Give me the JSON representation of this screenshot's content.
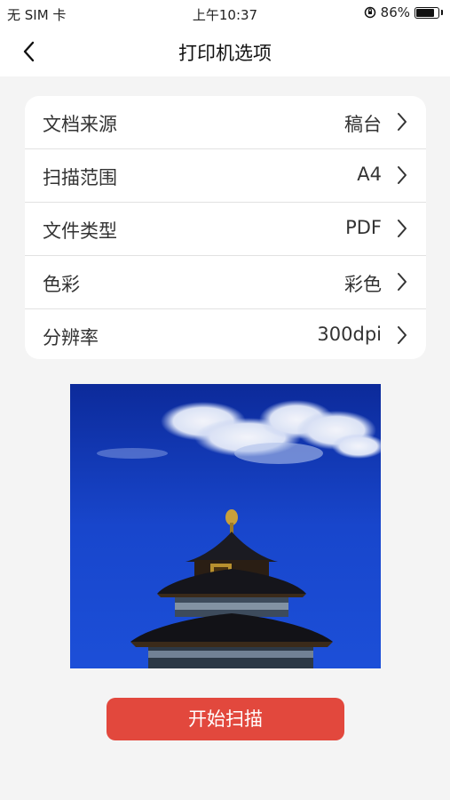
{
  "status_bar": {
    "carrier": "无 SIM 卡",
    "time": "上午10:37",
    "battery_percent": "86%",
    "battery_level": 0.86
  },
  "nav": {
    "title": "打印机选项",
    "back_icon": "chevron-left-icon"
  },
  "settings": {
    "rows": [
      {
        "label": "文档来源",
        "value": "稿台"
      },
      {
        "label": "扫描范围",
        "value": "A4"
      },
      {
        "label": "文件类型",
        "value": "PDF"
      },
      {
        "label": "色彩",
        "value": "彩色"
      },
      {
        "label": "分辨率",
        "value": "300dpi"
      }
    ]
  },
  "preview": {
    "icon": "scan-preview-image",
    "sky_color": "#1840c8"
  },
  "actions": {
    "start_scan": "开始扫描",
    "button_color": "#e2483d"
  }
}
